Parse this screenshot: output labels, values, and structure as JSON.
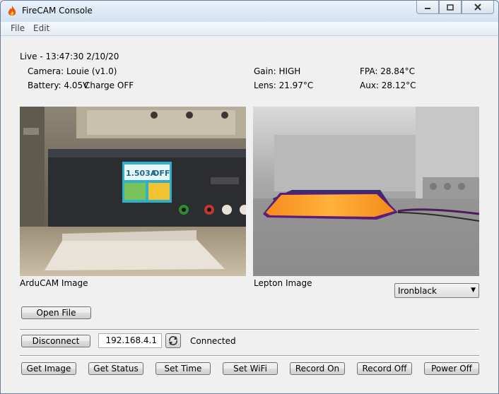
{
  "window": {
    "title": "FireCAM Console",
    "icons": {
      "app": "flame-icon",
      "minimize": "minimize-icon",
      "maximize": "maximize-icon",
      "close": "close-icon"
    }
  },
  "menu": {
    "items": [
      "File",
      "Edit"
    ]
  },
  "status": {
    "live": "Live - 13:47:30 2/10/20",
    "camera": "Camera: Louie  (v1.0)",
    "battery": "Battery: 4.05V",
    "charge": "Charge OFF",
    "gain": "Gain: HIGH",
    "lens": "Lens: 21.97°C",
    "fpa": "FPA: 28.84°C",
    "aux": "Aux: 28.12°C"
  },
  "images": {
    "arducam_label": "ArduCAM Image",
    "lepton_label": "Lepton Image",
    "psu_display_current": "1.503A",
    "psu_display_state": "OFF"
  },
  "palette": {
    "selected": "Ironblack"
  },
  "buttons": {
    "open_file": "Open File",
    "disconnect": "Disconnect",
    "get_image": "Get Image",
    "get_status": "Get Status",
    "set_time": "Set Time",
    "set_wifi": "Set WiFi",
    "record_on": "Record On",
    "record_off": "Record Off",
    "power_off": "Power Off"
  },
  "connection": {
    "ip": "192.168.4.1",
    "state": "Connected",
    "refresh_icon": "refresh-icon"
  }
}
